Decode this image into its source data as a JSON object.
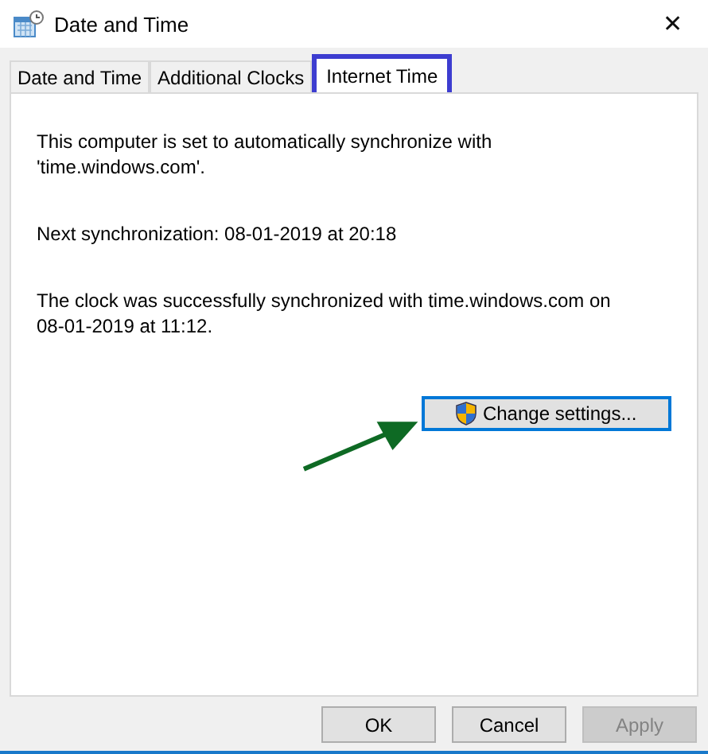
{
  "window": {
    "title": "Date and Time",
    "close": "✕"
  },
  "tabs": [
    {
      "label": "Date and Time",
      "selected": false
    },
    {
      "label": "Additional Clocks",
      "selected": false
    },
    {
      "label": "Internet Time",
      "selected": true
    }
  ],
  "paragraphs": [
    "This computer is set to automatically synchronize with 'time.windows.com'.",
    "Next synchronization: 08-01-2019 at 20:18",
    "The clock was successfully synchronized with time.windows.com on 08-01-2019 at 11:12."
  ],
  "change_button": {
    "label": "Change settings..."
  },
  "buttons": [
    {
      "label": "OK",
      "disabled": false
    },
    {
      "label": "Cancel",
      "disabled": false
    },
    {
      "label": "Apply",
      "disabled": true
    }
  ]
}
